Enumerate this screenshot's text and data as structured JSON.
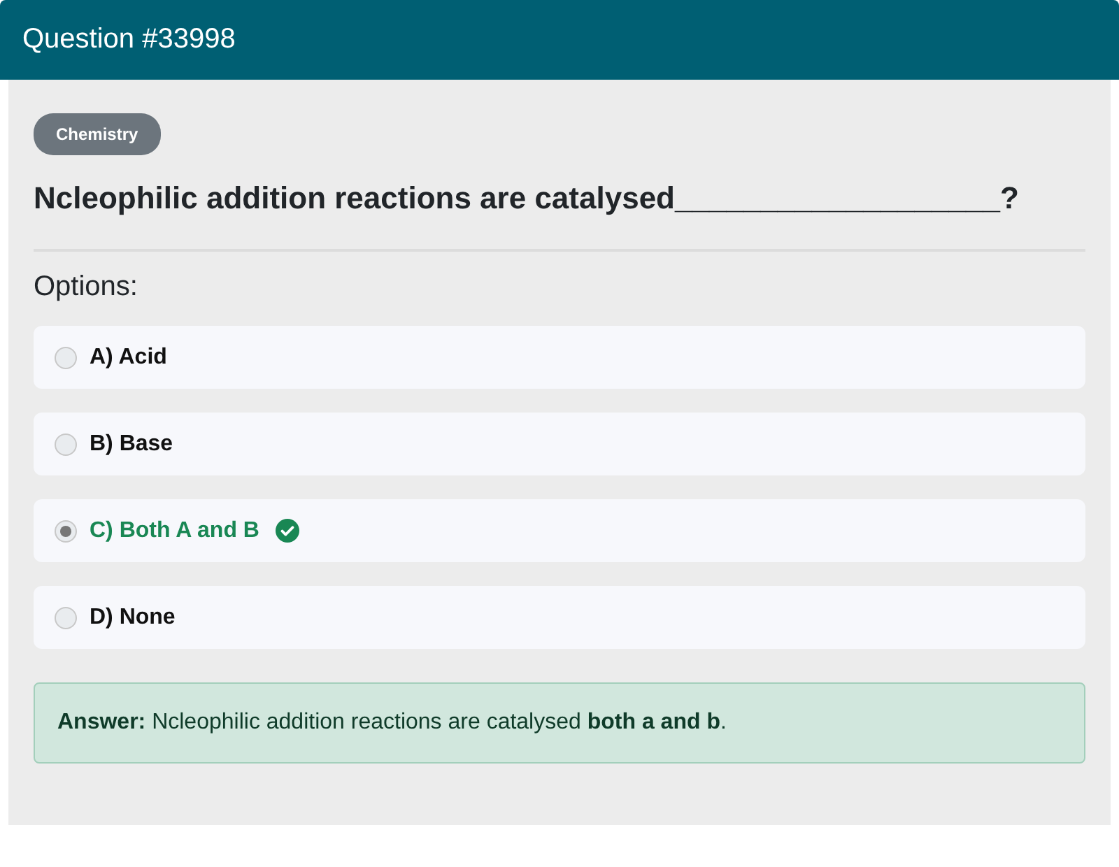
{
  "header": {
    "title": "Question #33998"
  },
  "category": "Chemistry",
  "question": "Ncleophilic addition reactions are catalysed___________________?",
  "options_label": "Options:",
  "options": [
    {
      "text": "A) Acid",
      "selected": false,
      "correct": false
    },
    {
      "text": "B) Base",
      "selected": false,
      "correct": false
    },
    {
      "text": "C) Both A and B",
      "selected": true,
      "correct": true
    },
    {
      "text": "D) None",
      "selected": false,
      "correct": false
    }
  ],
  "answer": "**Answer:** Ncleophilic addition reactions are catalysed **both a and b**."
}
